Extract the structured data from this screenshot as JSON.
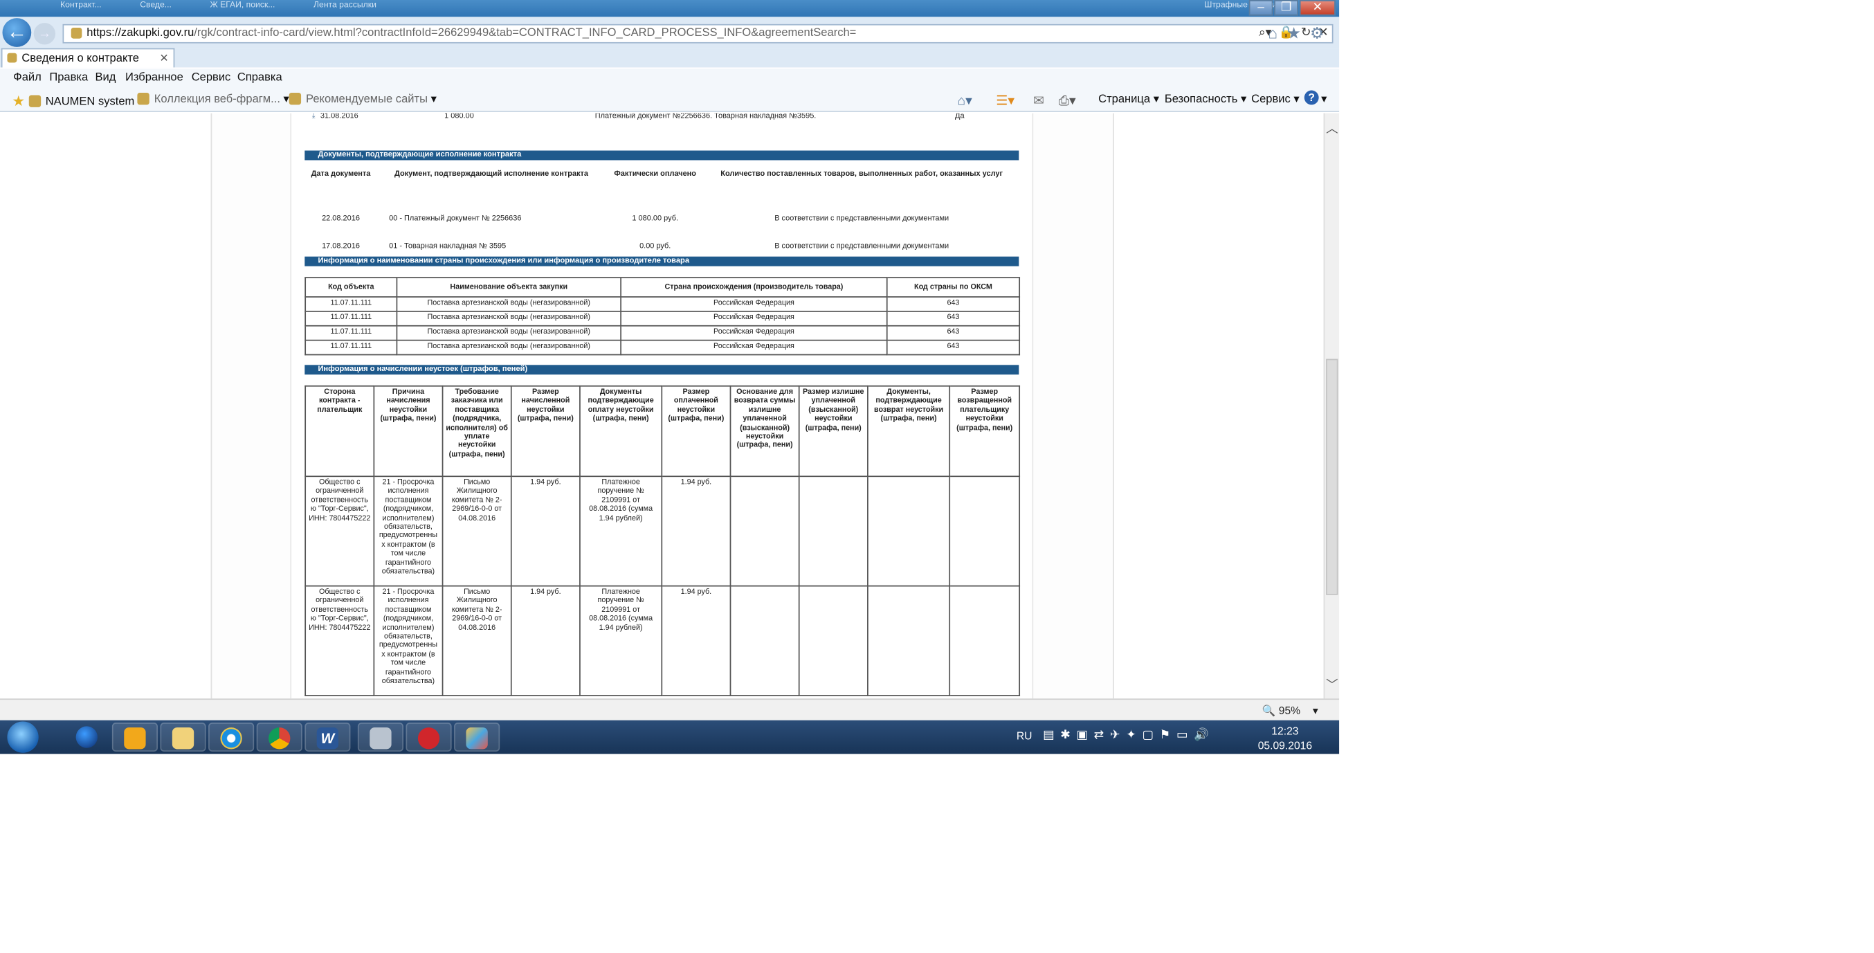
{
  "browser": {
    "url_domain": "https://zakupki.gov.ru",
    "url_rest": "/rgk/contract-info-card/view.html?contractInfoId=26629949&tab=CONTRACT_INFO_CARD_PROCESS_INFO&agreementSearch=",
    "tab_title": "Сведения о контракте",
    "tab_close": "✕",
    "menu": [
      "Файл",
      "Правка",
      "Вид",
      "Избранное",
      "Сервис",
      "Справка"
    ],
    "favorites": {
      "naumen": "NAUMEN system",
      "gallery": "Коллекция веб-фрагм...",
      "suggested": "Рекомендуемые сайты"
    },
    "commands": {
      "page": "Страница",
      "security": "Безопасность",
      "tools": "Сервис"
    },
    "zoom": "95%",
    "ghost_tabs": [
      "Контракт...",
      "Сведе...",
      "Ж ЕГАИ, поиск...",
      "Лента рассылки",
      "Штрафные санкции"
    ]
  },
  "document": {
    "prev_row": {
      "date": "31.08.2016",
      "amount": "1 080.00",
      "doc": "Платежный документ №2256636. Товарная накладная №3595.",
      "flag": "Да"
    },
    "section_execution": {
      "title": "Документы, подтверждающие исполнение контракта",
      "headers": [
        "Дата документа",
        "Документ, подтверждающий исполнение контракта",
        "Фактически оплачено",
        "Количество поставленных товаров, выполненных работ, оказанных услуг"
      ],
      "rows": [
        [
          "22.08.2016",
          "00 - Платежный документ № 2256636",
          "1 080.00 руб.",
          "В соответствии с представленными документами"
        ],
        [
          "17.08.2016",
          "01 - Товарная накладная № 3595",
          "0.00 руб.",
          "В соответствии с представленными документами"
        ]
      ]
    },
    "section_origin": {
      "title": "Информация о наименовании страны происхождения или информация о производителе товара",
      "headers": [
        "Код объекта",
        "Наименование объекта закупки",
        "Страна происхождения (производитель товара)",
        "Код страны по ОКСМ"
      ],
      "rows": [
        [
          "11.07.11.111",
          "Поставка артезианской воды (негазированной)",
          "Российская Федерация",
          "643"
        ],
        [
          "11.07.11.111",
          "Поставка артезианской воды (негазированной)",
          "Российская Федерация",
          "643"
        ],
        [
          "11.07.11.111",
          "Поставка артезианской воды (негазированной)",
          "Российская Федерация",
          "643"
        ],
        [
          "11.07.11.111",
          "Поставка артезианской воды (негазированной)",
          "Российская Федерация",
          "643"
        ]
      ]
    },
    "section_penalties": {
      "title": "Информация о начислении неустоек (штрафов, пеней)",
      "headers": [
        "Сторона контракта - плательщик",
        "Причина начисления неустойки (штрафа, пени)",
        "Требование заказчика или поставщика (подрядчика, исполнителя) об уплате неустойки (штрафа, пени)",
        "Размер начисленной неустойки (штрафа, пени)",
        "Документы подтверждающие оплату неустойки (штрафа, пени)",
        "Размер оплаченной неустойки (штрафа, пени)",
        "Основание для возврата суммы излишне уплаченной (взысканной) неустойки (штрафа, пени)",
        "Размер излишне уплаченной (взысканной) неустойки (штрафа, пени)",
        "Документы, подтверждающие возврат неустойки (штрафа, пени)",
        "Размер возвращенной плательщику неустойки (штрафа, пени)"
      ],
      "rows": [
        [
          "Общество с ограниченной ответственность ю \"Торг-Сервис\", ИНН: 7804475222",
          "21 - Просрочка исполнения поставщиком (подрядчиком, исполнителем) обязательств, предусмотренны х контрактом (в том числе гарантийного обязательства)",
          "Письмо Жилищного комитета № 2-2969/16-0-0 от 04.08.2016",
          "1.94 руб.",
          "Платежное поручение № 2109991 от 08.08.2016 (сумма 1.94 рублей)",
          "1.94 руб.",
          "",
          "",
          "",
          ""
        ],
        [
          "Общество с ограниченной ответственность ю \"Торг-Сервис\", ИНН: 7804475222",
          "21 - Просрочка исполнения поставщиком (подрядчиком, исполнителем) обязательств, предусмотренны х контрактом (в том числе гарантийного обязательства)",
          "Письмо Жилищного комитета № 2-2969/16-0-0 от 04.08.2016",
          "1.94 руб.",
          "Платежное поручение № 2109991 от 08.08.2016 (сумма 1.94 рублей)",
          "1.94 руб.",
          "",
          "",
          "",
          ""
        ]
      ]
    }
  },
  "taskbar": {
    "lang": "RU",
    "time": "12:23",
    "date": "05.09.2016"
  },
  "icons": {
    "back": "back-arrow-icon",
    "forward": "forward-arrow-icon",
    "search": "search-icon",
    "lock": "lock-icon",
    "refresh": "refresh-icon",
    "home": "home-icon",
    "star": "favorites-star-icon",
    "gear": "gear-icon"
  }
}
